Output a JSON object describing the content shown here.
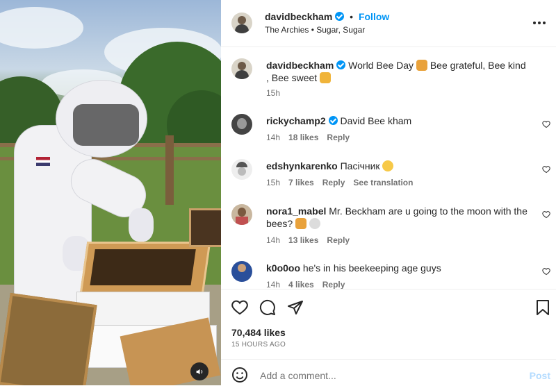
{
  "header": {
    "username": "davidbeckham",
    "separator": "•",
    "follow_label": "Follow",
    "song": "The Archies • Sugar, Sugar",
    "more_icon": "more-horizontal-icon"
  },
  "caption": {
    "username": "davidbeckham",
    "text": "World Bee Day",
    "text2": "Bee grateful, Bee kind , Bee sweet",
    "time": "15h"
  },
  "comments": [
    {
      "username": "rickychamp2",
      "verified": true,
      "text": "David Bee kham",
      "time": "14h",
      "likes": "18 likes",
      "reply": "Reply",
      "extra": ""
    },
    {
      "username": "edshynkarenko",
      "verified": false,
      "text": "Пасічник",
      "time": "15h",
      "likes": "7 likes",
      "reply": "Reply",
      "extra": "See translation"
    },
    {
      "username": "nora1_mabel",
      "verified": false,
      "text": "Mr. Beckham are u going to the moon with the bees?",
      "time": "14h",
      "likes": "13 likes",
      "reply": "Reply",
      "extra": ""
    },
    {
      "username": "k0o0oo",
      "verified": false,
      "text": "he's in his beekeeping age guys",
      "time": "14h",
      "likes": "4 likes",
      "reply": "Reply",
      "extra": ""
    }
  ],
  "footer": {
    "likes": "70,484 likes",
    "time": "15 HOURS AGO",
    "comment_placeholder": "Add a comment...",
    "post_label": "Post"
  },
  "colors": {
    "accent": "#0095f6",
    "text": "#262626",
    "muted": "#737373"
  }
}
